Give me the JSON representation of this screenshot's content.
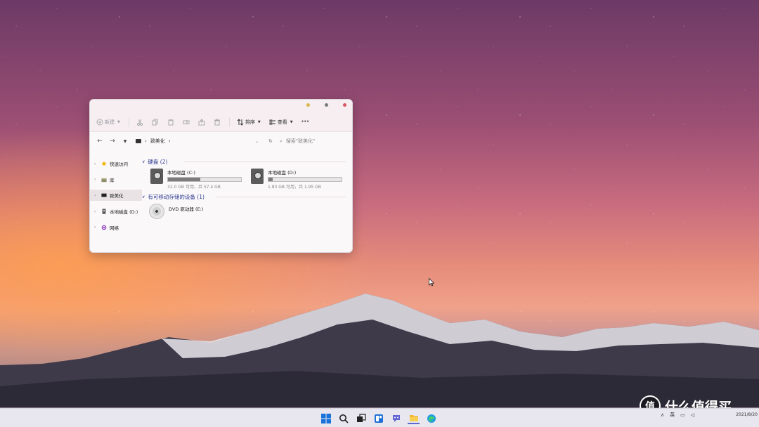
{
  "explorer": {
    "toolbar": {
      "new_label": "新建",
      "sort_label": "排序",
      "view_label": "查看",
      "more_label": "···"
    },
    "address": {
      "folder": "致美化",
      "search_placeholder": "搜索\"致美化\""
    },
    "sidebar": {
      "items": [
        {
          "label": "快速访问",
          "icon": "star-icon"
        },
        {
          "label": "库",
          "icon": "library-icon"
        },
        {
          "label": "致美化",
          "icon": "folder-icon",
          "selected": true
        },
        {
          "label": "本地磁盘 (D:)",
          "icon": "drive-icon"
        },
        {
          "label": "网络",
          "icon": "network-icon"
        }
      ]
    },
    "sections": {
      "hard_disks": "硬盘 (2)",
      "removable": "有可移动存储的设备 (1)"
    },
    "drives": [
      {
        "name": "本地磁盘 (C:)",
        "detail": "32.0 GB 可用，共 57.4 GB",
        "used_fraction": 0.44
      },
      {
        "name": "本地磁盘 (D:)",
        "detail": "1.83 GB 可用，共 1.95 GB",
        "used_fraction": 0.06
      }
    ],
    "dvd": {
      "name": "DVD 驱动器 (E:)"
    }
  },
  "taskbar": {
    "tray_lang": "英",
    "date": "2021/8/20",
    "icons": [
      "windows-start-icon",
      "search-icon",
      "task-view-icon",
      "widgets-icon",
      "chat-icon",
      "file-explorer-icon",
      "edge-icon"
    ]
  },
  "watermark": {
    "text": "什么值得买",
    "badge": "值"
  },
  "colors": {
    "accent": "#2b3a8f",
    "close": "#d9556a",
    "minimize": "#d8b84a"
  }
}
